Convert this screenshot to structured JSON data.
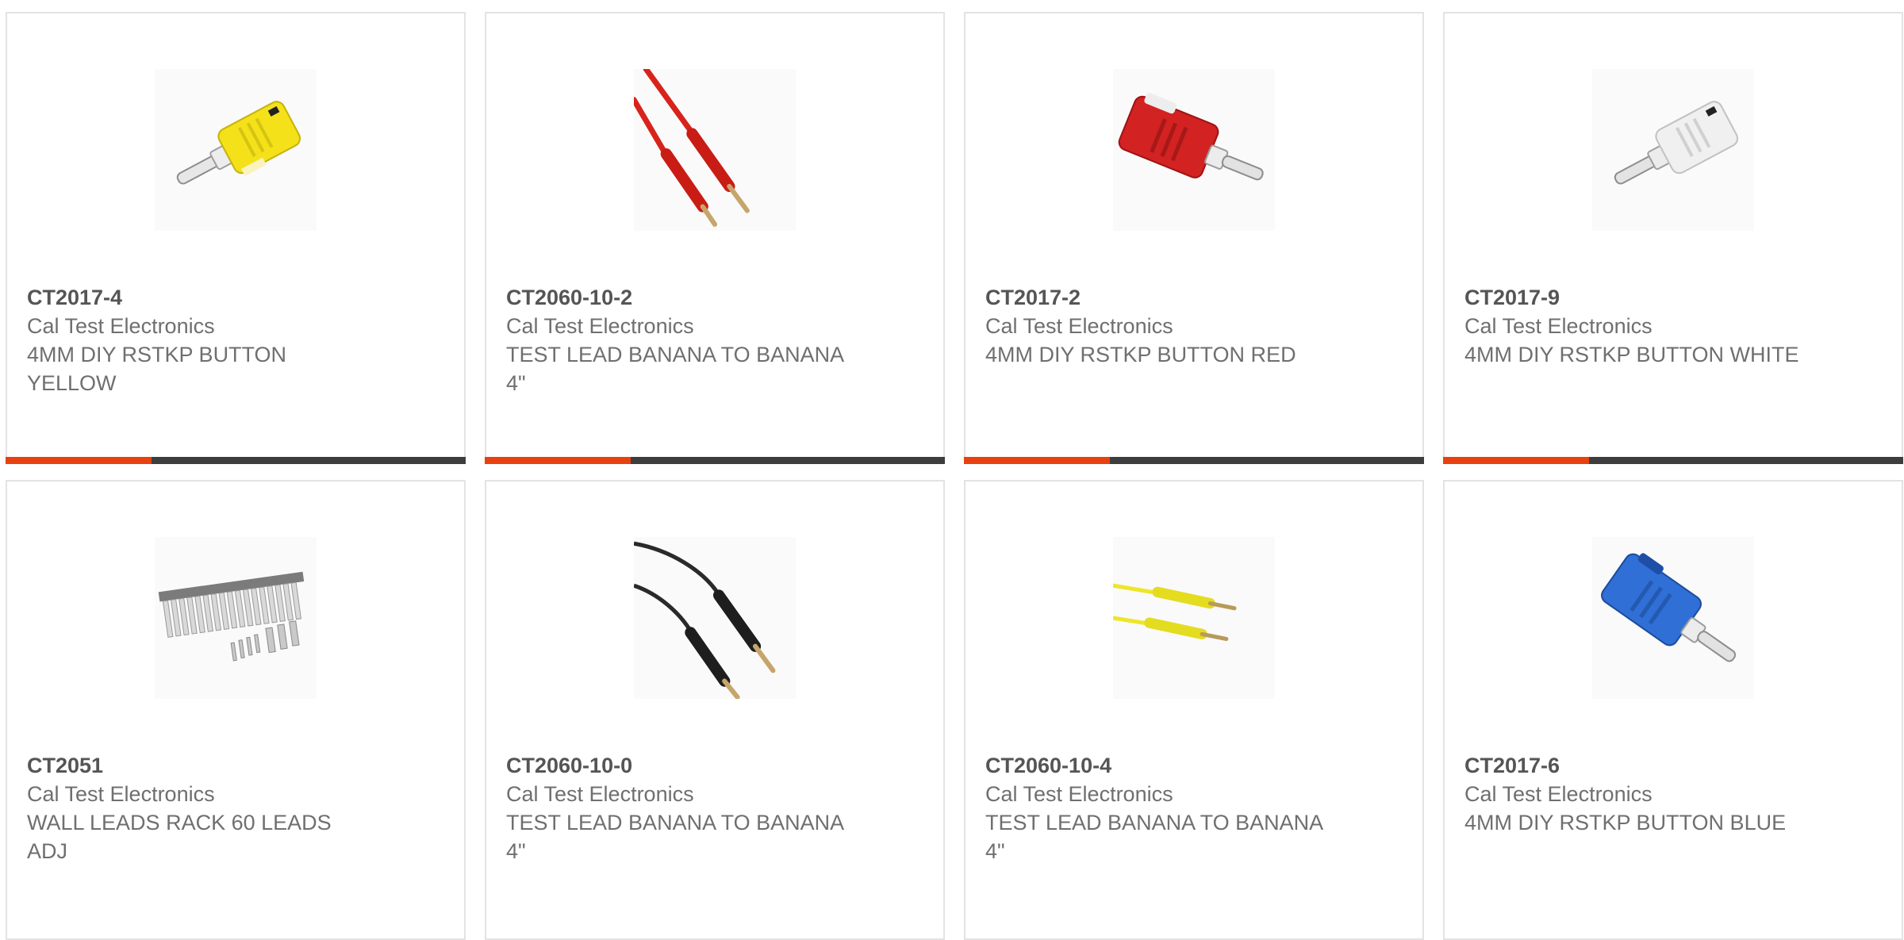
{
  "products": [
    {
      "sku": "CT2017-4",
      "manufacturer": "Cal Test Electronics",
      "description": "4MM DIY RSTKP BUTTON YELLOW",
      "icon": "yellow-banana-plug-icon",
      "color": "#f4e11a"
    },
    {
      "sku": "CT2060-10-2",
      "manufacturer": "Cal Test Electronics",
      "description": "TEST LEAD BANANA TO BANANA 4\"",
      "icon": "red-test-lead-icon",
      "color": "#d8231c"
    },
    {
      "sku": "CT2017-2",
      "manufacturer": "Cal Test Electronics",
      "description": "4MM DIY RSTKP BUTTON RED",
      "icon": "red-banana-plug-icon",
      "color": "#d32222"
    },
    {
      "sku": "CT2017-9",
      "manufacturer": "Cal Test Electronics",
      "description": "4MM DIY RSTKP BUTTON WHITE",
      "icon": "white-banana-plug-icon",
      "color": "#e6e6e6"
    },
    {
      "sku": "CT2051",
      "manufacturer": "Cal Test Electronics",
      "description": "WALL LEADS RACK 60 LEADS ADJ",
      "icon": "lead-rack-icon",
      "color": "#9a9a9a"
    },
    {
      "sku": "CT2060-10-0",
      "manufacturer": "Cal Test Electronics",
      "description": "TEST LEAD BANANA TO BANANA 4\"",
      "icon": "black-test-lead-icon",
      "color": "#2a2a2a"
    },
    {
      "sku": "CT2060-10-4",
      "manufacturer": "Cal Test Electronics",
      "description": "TEST LEAD BANANA TO BANANA 4\"",
      "icon": "yellow-test-lead-icon",
      "color": "#ede62a"
    },
    {
      "sku": "CT2017-6",
      "manufacturer": "Cal Test Electronics",
      "description": "4MM DIY RSTKP BUTTON BLUE",
      "icon": "blue-banana-plug-icon",
      "color": "#2f6fd6"
    }
  ],
  "colors": {
    "accent": "#e8410f",
    "bar_dark": "#3d3d3d",
    "card_border": "#e3e3e3",
    "text": "#6f6f6f"
  }
}
